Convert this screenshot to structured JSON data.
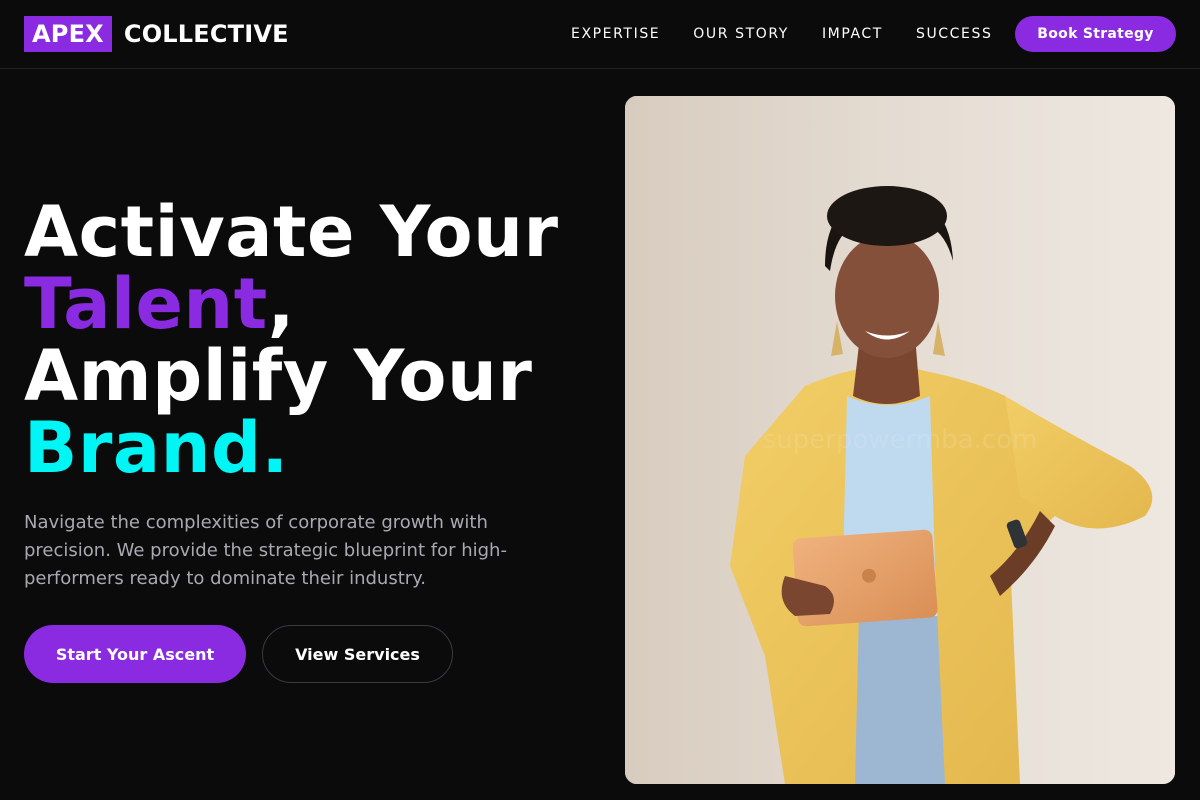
{
  "header": {
    "logo_mark": "APEX",
    "logo_word": "COLLECTIVE",
    "nav": [
      "EXPERTISE",
      "OUR STORY",
      "IMPACT",
      "SUCCESS"
    ],
    "cta": "Book Strategy"
  },
  "hero": {
    "headline": {
      "line1": "Activate Your",
      "line2_highlight": "Talent",
      "line2_rest": ",",
      "line3": "Amplify Your",
      "line4": "Brand."
    },
    "subtext": "Navigate the complexities of corporate growth with precision. We provide the strategic blueprint for high-performers ready to dominate their industry.",
    "primary_button": "Start Your Ascent",
    "secondary_button": "View Services",
    "image_watermark": "superpowermba.com"
  },
  "colors": {
    "accent_purple": "#8a2be2",
    "accent_cyan": "#00f5f5",
    "background": "#0b0b0c"
  }
}
